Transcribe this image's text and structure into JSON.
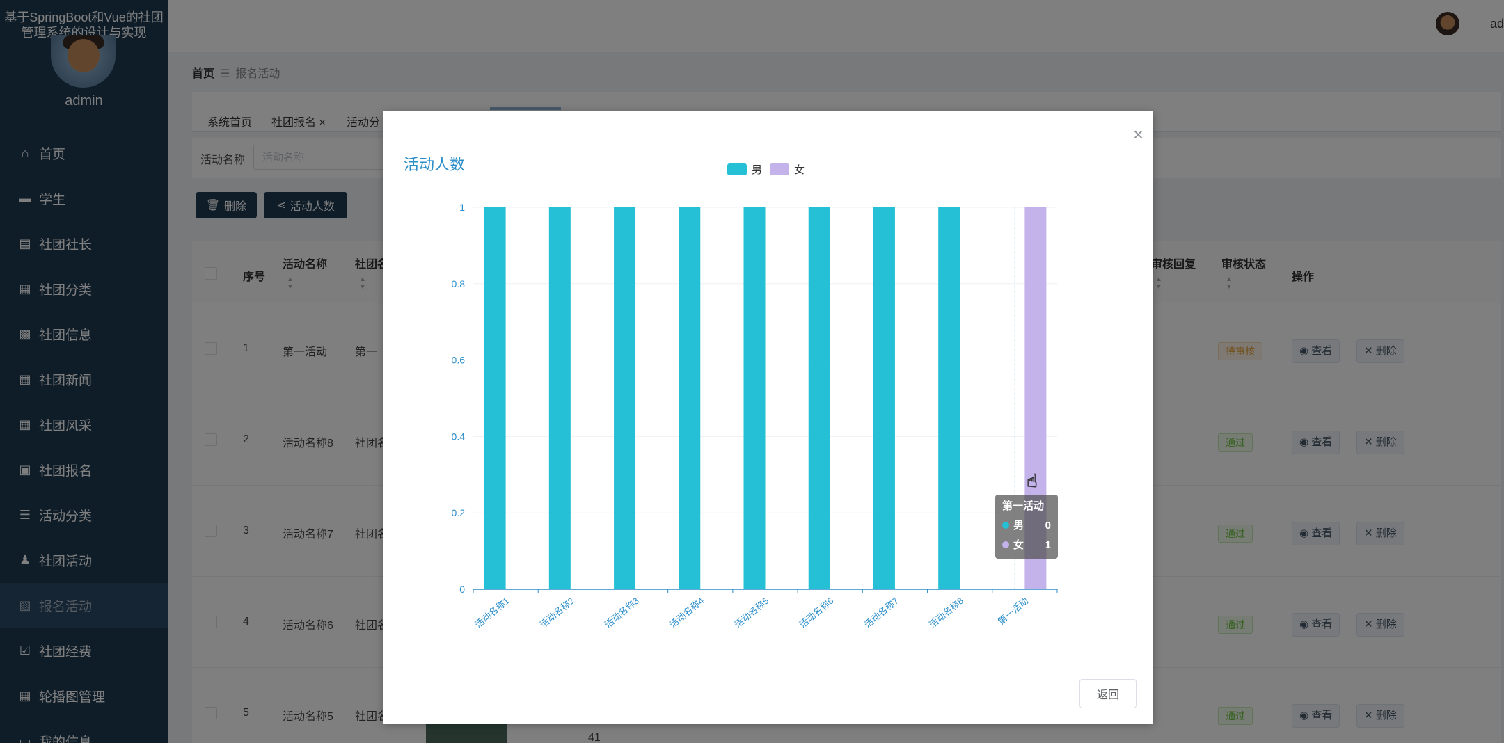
{
  "app": {
    "title": "基于SpringBoot和Vue的社团管理系统的设计与实现",
    "user": "admin",
    "top_user_partial": "ad"
  },
  "sidebar": {
    "items": [
      {
        "label": "首页",
        "icon": "home-icon",
        "glyph": "⌂"
      },
      {
        "label": "学生",
        "icon": "monitor-icon",
        "glyph": "▬"
      },
      {
        "label": "社团社长",
        "icon": "clipboard-icon",
        "glyph": "▤"
      },
      {
        "label": "社团分类",
        "icon": "grid-icon",
        "glyph": "▦"
      },
      {
        "label": "社团信息",
        "icon": "chat-icon",
        "glyph": "▩"
      },
      {
        "label": "社团新闻",
        "icon": "grid-icon",
        "glyph": "▦"
      },
      {
        "label": "社团风采",
        "icon": "grid-icon",
        "glyph": "▦"
      },
      {
        "label": "社团报名",
        "icon": "inbox-icon",
        "glyph": "▣"
      },
      {
        "label": "活动分类",
        "icon": "list-icon",
        "glyph": "☰"
      },
      {
        "label": "社团活动",
        "icon": "user-icon",
        "glyph": "♟"
      },
      {
        "label": "报名活动",
        "icon": "doc-x-icon",
        "glyph": "▧",
        "active": true
      },
      {
        "label": "社团经费",
        "icon": "doc-check-icon",
        "glyph": "☑"
      },
      {
        "label": "轮播图管理",
        "icon": "grid-icon",
        "glyph": "▦"
      },
      {
        "label": "我的信息",
        "icon": "doc-icon",
        "glyph": "▭"
      }
    ]
  },
  "breadcrumb": {
    "home": "首页",
    "separator": "☰",
    "current": "报名活动"
  },
  "tabs": [
    "系统首页",
    "社团报名 ×",
    "活动分"
  ],
  "search": {
    "label": "活动名称",
    "placeholder": "活动名称"
  },
  "toolbar": {
    "delete_label": "删除",
    "stats_label": "活动人数"
  },
  "table": {
    "headers": {
      "index": "序号",
      "name": "活动名称",
      "club": "社团名",
      "reply": "审核回复",
      "status": "审核状态",
      "ops": "操作"
    },
    "rows": [
      {
        "index": "1",
        "name": "第一活动",
        "club": "第一",
        "status": "待审核",
        "status_type": "pending"
      },
      {
        "index": "2",
        "name": "活动名称8",
        "club": "社团名",
        "status": "通过",
        "status_type": "pass"
      },
      {
        "index": "3",
        "name": "活动名称7",
        "club": "社团名",
        "status": "通过",
        "status_type": "pass"
      },
      {
        "index": "4",
        "name": "活动名称6",
        "club": "社团名",
        "status": "通过",
        "status_type": "pass"
      },
      {
        "index": "5",
        "name": "活动名称5",
        "club": "社团名",
        "status": "通过",
        "status_type": "pass"
      }
    ],
    "view_label": "查看",
    "delete_label": "删除",
    "partial_value": "41"
  },
  "modal": {
    "close_glyph": "×",
    "return_label": "返回"
  },
  "colors": {
    "male": "#26c0d6",
    "female": "#c3b3ea",
    "title": "#2c8ec9",
    "axis": "#2c8ec9"
  },
  "chart_data": {
    "type": "bar",
    "title": "活动人数",
    "categories": [
      "活动名称1",
      "活动名称2",
      "活动名称3",
      "活动名称4",
      "活动名称5",
      "活动名称6",
      "活动名称7",
      "活动名称8",
      "第一活动"
    ],
    "series": [
      {
        "name": "男",
        "values": [
          1,
          1,
          1,
          1,
          1,
          1,
          1,
          1,
          0
        ]
      },
      {
        "name": "女",
        "values": [
          0,
          0,
          0,
          0,
          0,
          0,
          0,
          0,
          1
        ]
      }
    ],
    "ylim": [
      0,
      1
    ],
    "yticks": [
      "0",
      "0.2",
      "0.4",
      "0.6",
      "0.8",
      "1"
    ],
    "legend_position": "top-center",
    "grid": true,
    "tooltip": {
      "title": "第一活动",
      "items": [
        {
          "name": "男",
          "value": "0"
        },
        {
          "name": "女",
          "value": "1"
        }
      ]
    }
  }
}
